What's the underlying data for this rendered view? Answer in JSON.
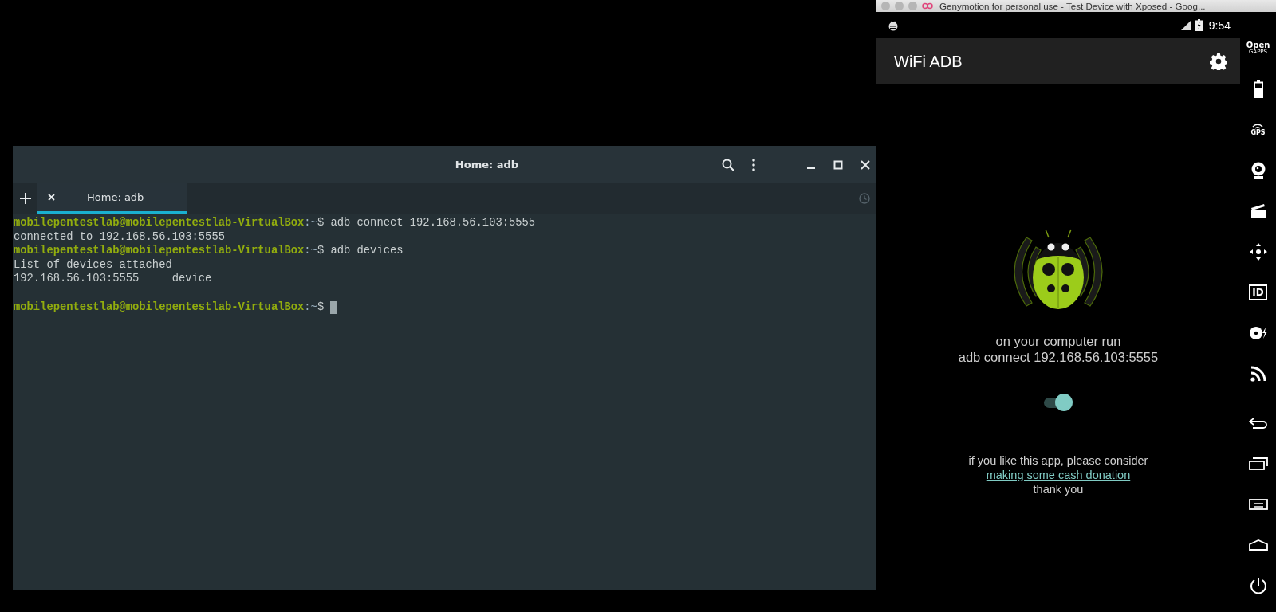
{
  "terminal": {
    "title": "Home: adb",
    "tabs": [
      {
        "label": "Home: adb",
        "selected": true
      }
    ],
    "lines": [
      {
        "kind": "prompt",
        "user": "mobilepentestlab@mobilepentestlab-VirtualBox",
        "path": ":~",
        "symbol": "$",
        "command": "adb connect 192.168.56.103:5555"
      },
      {
        "kind": "output",
        "text": "connected to 192.168.56.103:5555"
      },
      {
        "kind": "prompt",
        "user": "mobilepentestlab@mobilepentestlab-VirtualBox",
        "path": ":~",
        "symbol": "$",
        "command": "adb devices"
      },
      {
        "kind": "output",
        "text": "List of devices attached"
      },
      {
        "kind": "output",
        "text": "192.168.56.103:5555     device"
      },
      {
        "kind": "blank"
      },
      {
        "kind": "prompt",
        "user": "mobilepentestlab@mobilepentestlab-VirtualBox",
        "path": ":~",
        "symbol": "$",
        "cursor": true
      }
    ]
  },
  "emulator": {
    "window_title": "Genymotion for personal use - Test Device with Xposed - Goog...",
    "status_bar": {
      "time": "9:54"
    },
    "app_bar": {
      "title": "WiFi ADB"
    },
    "instructions": [
      "on your computer run",
      "adb connect 192.168.56.103:5555"
    ],
    "switch": {
      "on": true
    },
    "donation": {
      "text": "if you like this app, please consider",
      "link": "making some cash donation",
      "thanks": "thank you"
    },
    "side_toolbar": [
      {
        "kind": "gapps",
        "label": "Open",
        "sublabel": "GAPPS"
      },
      {
        "kind": "battery"
      },
      {
        "kind": "gps",
        "label": "GPS"
      },
      {
        "kind": "camera"
      },
      {
        "kind": "media"
      },
      {
        "kind": "dpad"
      },
      {
        "kind": "id",
        "label": "ID"
      },
      {
        "kind": "disk"
      },
      {
        "kind": "rss"
      },
      {
        "kind": "back"
      },
      {
        "kind": "recent"
      },
      {
        "kind": "menu"
      },
      {
        "kind": "home"
      },
      {
        "kind": "power"
      }
    ]
  }
}
